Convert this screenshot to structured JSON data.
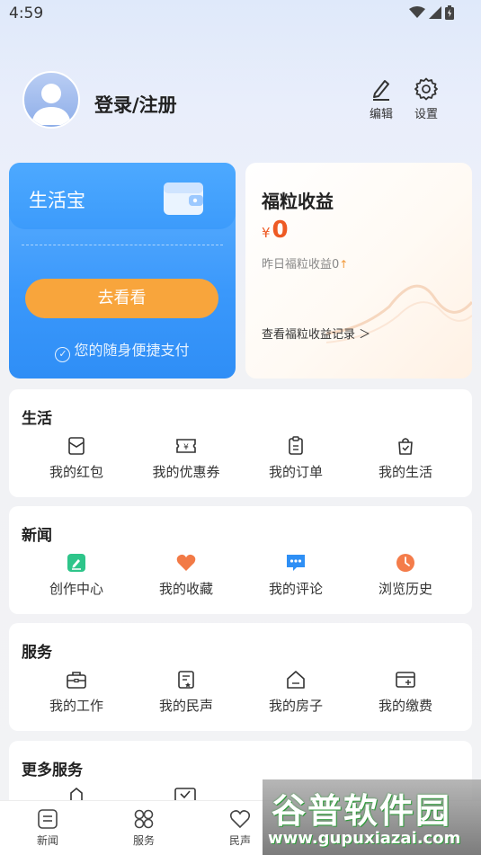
{
  "status_bar": {
    "time": "4:59"
  },
  "profile": {
    "login_label": "登录/注册"
  },
  "top_actions": {
    "edit_label": "编辑",
    "settings_label": "设置"
  },
  "wallet_card": {
    "title": "生活宝",
    "button_label": "去看看",
    "subtitle": "您的随身便捷支付",
    "accent_color": "#3a98fb",
    "button_color": "#f8a53c"
  },
  "points_card": {
    "title": "福粒收益",
    "currency": "¥",
    "value": "0",
    "yesterday_label": "昨日福粒收益0",
    "record_link": "查看福粒收益记录 ＞",
    "value_color": "#ee5a24"
  },
  "sections": {
    "life": {
      "title": "生活",
      "items": [
        {
          "label": "我的红包",
          "icon": "red-packet-icon"
        },
        {
          "label": "我的优惠券",
          "icon": "coupon-icon"
        },
        {
          "label": "我的订单",
          "icon": "order-icon"
        },
        {
          "label": "我的生活",
          "icon": "shopping-bag-icon"
        }
      ]
    },
    "news": {
      "title": "新闻",
      "items": [
        {
          "label": "创作中心",
          "icon": "edit-square-icon"
        },
        {
          "label": "我的收藏",
          "icon": "heart-icon"
        },
        {
          "label": "我的评论",
          "icon": "comment-icon"
        },
        {
          "label": "浏览历史",
          "icon": "clock-icon"
        }
      ]
    },
    "service": {
      "title": "服务",
      "items": [
        {
          "label": "我的工作",
          "icon": "briefcase-icon"
        },
        {
          "label": "我的民声",
          "icon": "document-icon"
        },
        {
          "label": "我的房子",
          "icon": "house-icon"
        },
        {
          "label": "我的缴费",
          "icon": "bill-icon"
        }
      ]
    },
    "more": {
      "title": "更多服务"
    }
  },
  "tab_bar": {
    "tabs": [
      {
        "label": "新闻",
        "icon": "news-icon"
      },
      {
        "label": "服务",
        "icon": "services-icon"
      },
      {
        "label": "民声",
        "icon": "heart-outline-icon"
      }
    ]
  },
  "watermark": {
    "title": "谷普软件园",
    "url": "www.gupuxiazai.com"
  }
}
